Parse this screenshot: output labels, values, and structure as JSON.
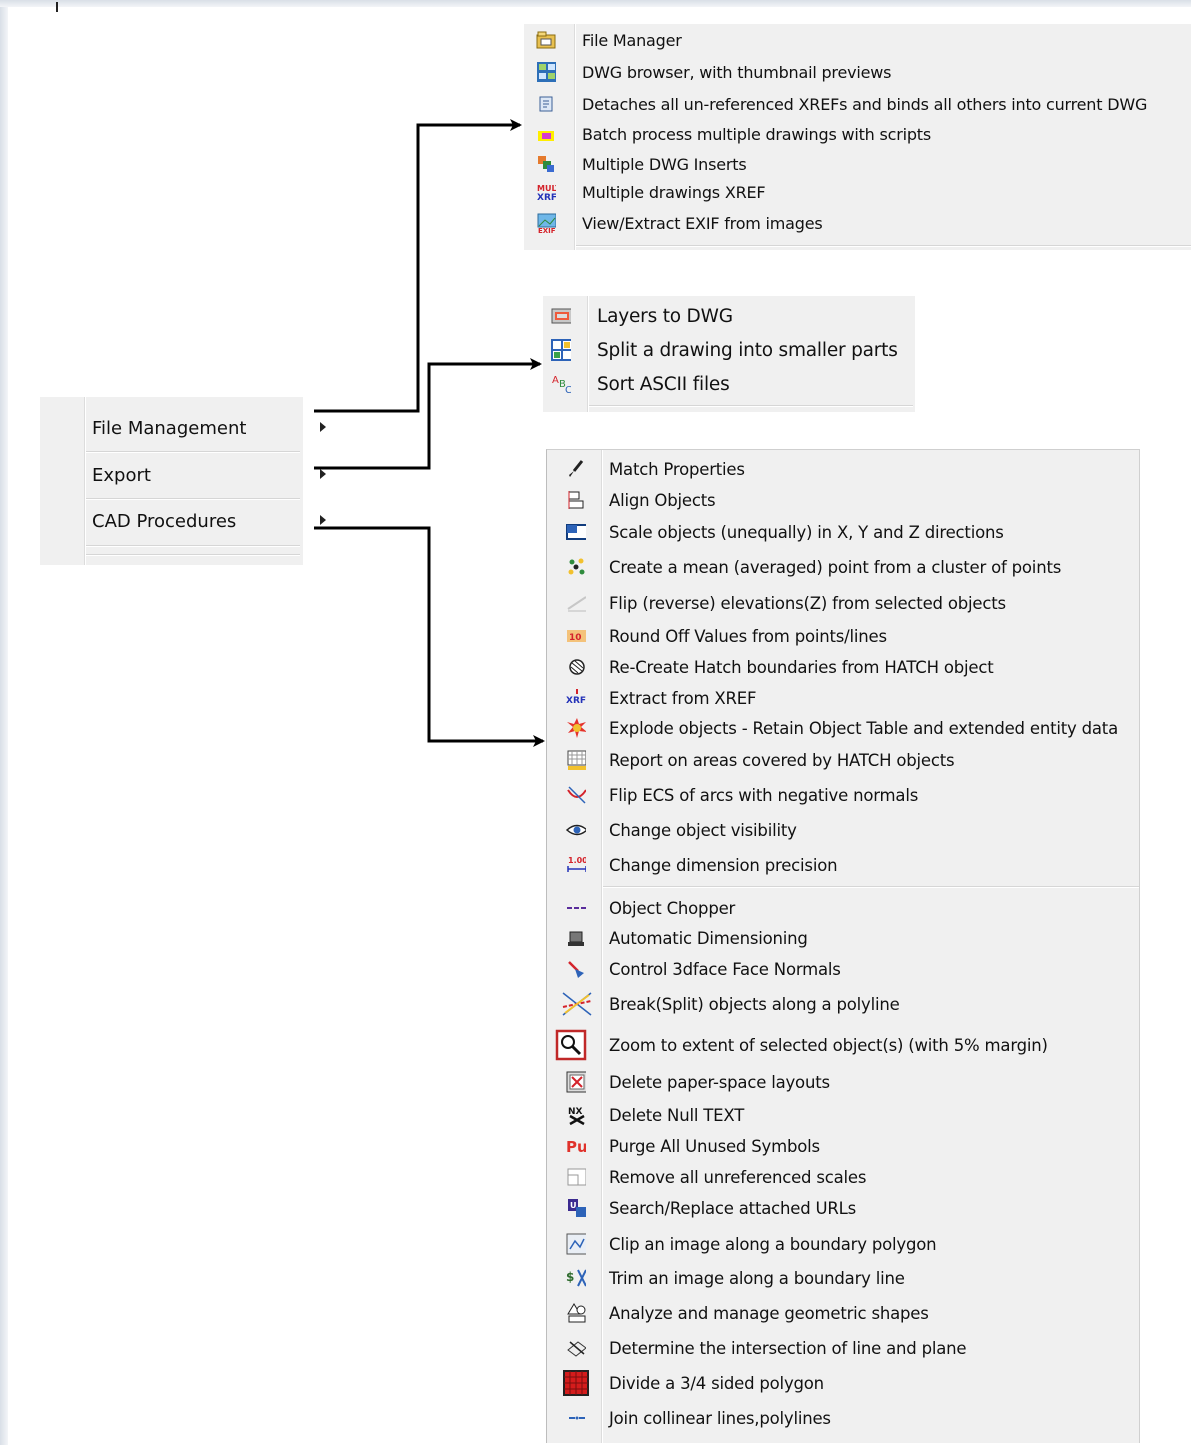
{
  "main_menu": {
    "items": [
      {
        "label": "File Management"
      },
      {
        "label": "Export"
      },
      {
        "label": "CAD Procedures"
      }
    ]
  },
  "file_management_menu": {
    "items": [
      {
        "label": "File Manager",
        "icon": "folder-icon"
      },
      {
        "label": "DWG browser, with thumbnail previews",
        "icon": "thumbnail-browser-icon"
      },
      {
        "label": "Detaches all un-referenced XREFs and binds all others into current DWG",
        "icon": "xref-bind-icon"
      },
      {
        "label": "Batch process multiple drawings with scripts",
        "icon": "batch-script-icon"
      },
      {
        "label": "Multiple DWG Inserts",
        "icon": "multi-insert-icon"
      },
      {
        "label": "Multiple drawings XREF",
        "icon": "multi-xref-icon"
      },
      {
        "label": "View/Extract EXIF from images",
        "icon": "exif-icon"
      }
    ]
  },
  "export_menu": {
    "items": [
      {
        "label": "Layers to DWG",
        "icon": "layers-icon"
      },
      {
        "label": "Split a drawing into smaller parts",
        "icon": "split-drawing-icon"
      },
      {
        "label": "Sort ASCII files",
        "icon": "sort-ascii-icon"
      }
    ]
  },
  "cad_procedures_menu": {
    "group1": [
      {
        "label": "Match Properties",
        "icon": "brush-icon"
      },
      {
        "label": "Align Objects",
        "icon": "align-icon"
      },
      {
        "label": "Scale objects (unequally) in X, Y and Z directions",
        "icon": "scale-icon"
      },
      {
        "label": "Create a mean (averaged) point from a cluster of points",
        "icon": "point-cluster-icon"
      },
      {
        "label": "Flip (reverse) elevations(Z) from selected objects",
        "icon": "flip-elevation-icon"
      },
      {
        "label": "Round Off Values from points/lines",
        "icon": "round-off-icon"
      },
      {
        "label": "Re-Create Hatch boundaries from HATCH object",
        "icon": "hatch-boundary-icon"
      },
      {
        "label": "Extract from XREF",
        "icon": "extract-xref-icon"
      },
      {
        "label": "Explode objects - Retain Object Table and extended entity data",
        "icon": "explode-icon"
      },
      {
        "label": "Report on areas covered by HATCH objects",
        "icon": "hatch-area-icon"
      },
      {
        "label": "Flip ECS of arcs with negative normals",
        "icon": "flip-ecs-icon"
      },
      {
        "label": "Change object visibility",
        "icon": "eye-icon"
      },
      {
        "label": "Change dimension precision",
        "icon": "dimension-precision-icon"
      }
    ],
    "group2": [
      {
        "label": "Object Chopper",
        "icon": "chopper-icon"
      },
      {
        "label": "Automatic Dimensioning",
        "icon": "auto-dimension-icon"
      },
      {
        "label": "Control 3dface Face Normals",
        "icon": "face-normals-icon"
      },
      {
        "label": "Break(Split) objects along a polyline",
        "icon": "break-split-icon"
      },
      {
        "label": "Zoom to extent of selected object(s) (with 5% margin)",
        "icon": "zoom-extent-icon"
      },
      {
        "label": "Delete paper-space layouts",
        "icon": "delete-layout-icon"
      },
      {
        "label": "Delete Null TEXT",
        "icon": "delete-null-text-icon"
      },
      {
        "label": "Purge All Unused Symbols",
        "icon": "purge-icon"
      },
      {
        "label": "Remove all unreferenced scales",
        "icon": "remove-scales-icon"
      },
      {
        "label": "Search/Replace attached URLs",
        "icon": "search-url-icon"
      },
      {
        "label": "Clip an image along a boundary polygon",
        "icon": "clip-image-icon"
      },
      {
        "label": "Trim an image along a boundary line",
        "icon": "trim-image-icon"
      },
      {
        "label": "Analyze and manage geometric shapes",
        "icon": "geometric-shapes-icon"
      },
      {
        "label": "Determine the intersection of line and plane",
        "icon": "intersection-icon"
      },
      {
        "label": "Divide a 3/4 sided polygon",
        "icon": "divide-polygon-icon"
      },
      {
        "label": "Join collinear lines,polylines",
        "icon": "join-lines-icon"
      }
    ]
  }
}
